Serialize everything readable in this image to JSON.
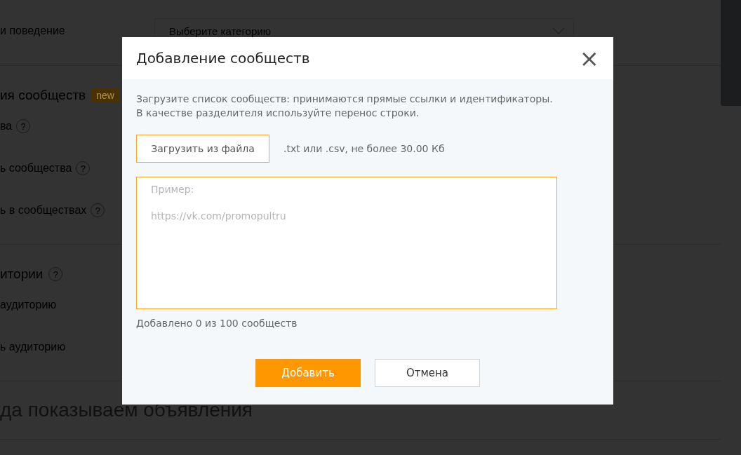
{
  "background_page": {
    "sections": [
      {
        "items": [
          {
            "label": "и поведение",
            "select_placeholder": "Выберите категорию"
          }
        ]
      },
      {
        "heading": "ия сообществ",
        "badge": "new",
        "items": [
          {
            "label": "ва",
            "help": "?"
          },
          {
            "label": "ь сообщества",
            "help": "?"
          },
          {
            "label": "ь в сообществах",
            "help": "?"
          }
        ]
      },
      {
        "heading": "итории",
        "help": "?",
        "items": [
          {
            "label": "аудиторию"
          },
          {
            "label": "ь аудиторию"
          }
        ]
      }
    ],
    "page_title": "да показываем объявления"
  },
  "dialog": {
    "title": "Добавление сообществ",
    "close": "×",
    "description": "Загрузите список сообществ: принимаются прямые ссылки и идентификаторы.\nВ качестве разделителя используйте перенос строки.",
    "upload_button": "Загрузить из файла",
    "upload_hint": ".txt или .csv, не более 30.00 Кб",
    "textarea": {
      "placeholder": "Пример:\n\nhttps://vk.com/promopultru"
    },
    "counter": "Добавлено 0 из 100 сообществ",
    "buttons": [
      {
        "label": "Добавить",
        "kind": "primary"
      },
      {
        "label": "Отмена",
        "kind": "secondary"
      }
    ]
  }
}
